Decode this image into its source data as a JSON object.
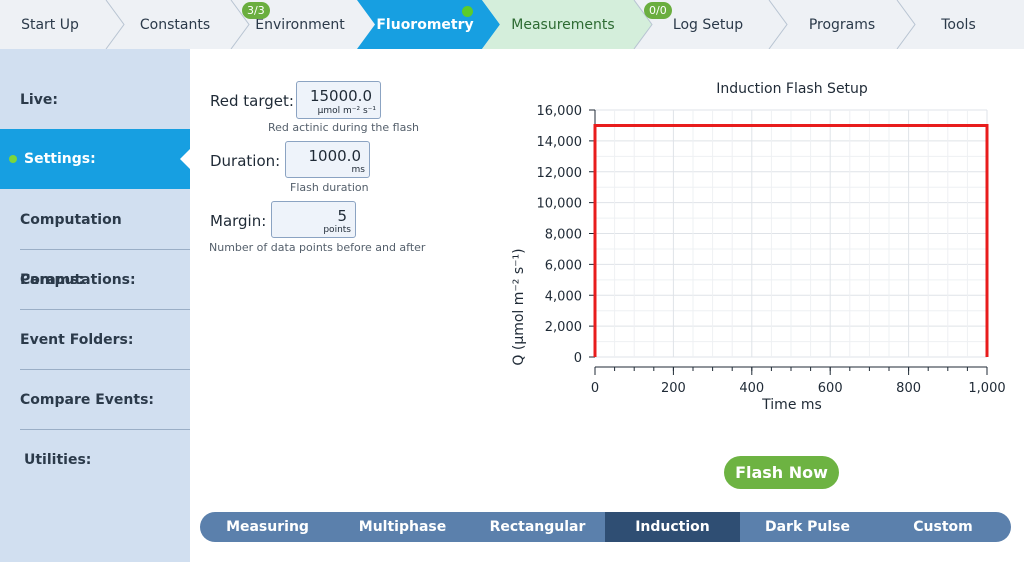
{
  "steps": [
    {
      "label": "Start Up"
    },
    {
      "label": "Constants"
    },
    {
      "label": "Environment",
      "badge": "3/3"
    },
    {
      "label": "Fluorometry",
      "active": true
    },
    {
      "label": "Measurements"
    },
    {
      "label": "Log Setup",
      "badge": "0/0"
    },
    {
      "label": "Programs"
    },
    {
      "label": "Tools"
    }
  ],
  "sidebar": {
    "items": [
      {
        "label": "Live:"
      },
      {
        "label": "Settings:",
        "active": true
      },
      {
        "label": "Computation Params:"
      },
      {
        "label": "Computations:"
      },
      {
        "label": "Event Folders:"
      },
      {
        "label": "Compare Events:"
      },
      {
        "label": "Utilities:"
      }
    ]
  },
  "settings": {
    "red_target": {
      "label": "Red target:",
      "value": "15000.0",
      "unit": "µmol m⁻² s⁻¹",
      "hint": "Red actinic during the flash"
    },
    "duration": {
      "label": "Duration:",
      "value": "1000.0",
      "unit": "ms",
      "hint": "Flash duration"
    },
    "margin": {
      "label": "Margin:",
      "value": "5",
      "unit": "points",
      "hint": "Number of data points before and after"
    }
  },
  "chart_data": {
    "type": "line",
    "title": "Induction Flash Setup",
    "xlabel": "Time ms",
    "ylabel": "Q (µmol m⁻² s⁻¹)",
    "xlim": [
      0,
      1000
    ],
    "ylim": [
      0,
      16000
    ],
    "xticks": [
      "0",
      "200",
      "400",
      "600",
      "800",
      "1,000"
    ],
    "yticks": [
      "0",
      "2,000",
      "4,000",
      "6,000",
      "8,000",
      "10,000",
      "12,000",
      "14,000",
      "16,000"
    ],
    "grid": true,
    "series": [
      {
        "color": "#e81c1c",
        "x": [
          0,
          0,
          1000,
          1000
        ],
        "y": [
          0,
          15000,
          15000,
          0
        ]
      }
    ]
  },
  "flash_button": "Flash Now",
  "tabs": [
    {
      "label": "Measuring"
    },
    {
      "label": "Multiphase"
    },
    {
      "label": "Rectangular"
    },
    {
      "label": "Induction",
      "active": true
    },
    {
      "label": "Dark Pulse"
    },
    {
      "label": "Custom"
    }
  ],
  "colors": {
    "accent": "#179fe1",
    "green": "#6db342",
    "series": "#e81c1c"
  }
}
